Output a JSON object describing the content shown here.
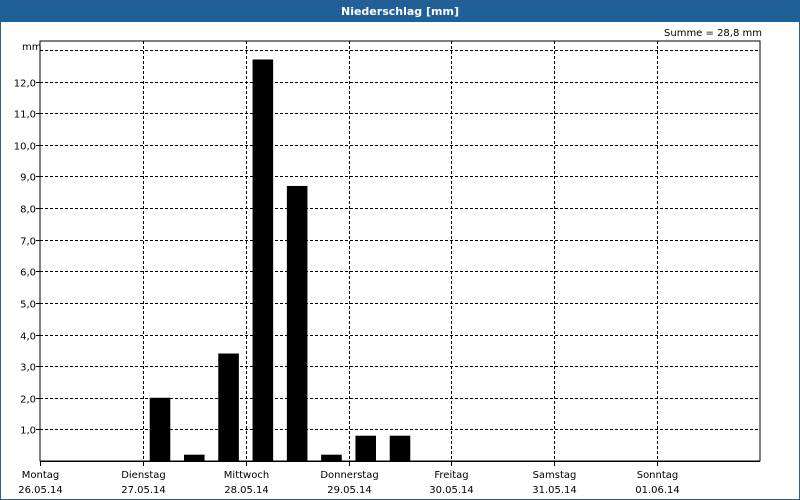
{
  "window": {
    "title": "Niederschlag [mm]"
  },
  "summary": {
    "text": "Summe = 28,8 mm"
  },
  "chart_data": {
    "type": "bar",
    "title": "Niederschlag [mm]",
    "ylabel": "mm",
    "ylim": [
      0,
      13
    ],
    "yticks": [
      {
        "value": 1,
        "label": "1,0"
      },
      {
        "value": 2,
        "label": "2,0"
      },
      {
        "value": 3,
        "label": "3,0"
      },
      {
        "value": 4,
        "label": "4,0"
      },
      {
        "value": 5,
        "label": "5,0"
      },
      {
        "value": 6,
        "label": "6,0"
      },
      {
        "value": 7,
        "label": "7,0"
      },
      {
        "value": 8,
        "label": "8,0"
      },
      {
        "value": 9,
        "label": "9,0"
      },
      {
        "value": 10,
        "label": "10,0"
      },
      {
        "value": 11,
        "label": "11,0"
      },
      {
        "value": 12,
        "label": "12,0"
      }
    ],
    "days": [
      {
        "name": "Montag",
        "date": "26.05.14"
      },
      {
        "name": "Dienstag",
        "date": "27.05.14"
      },
      {
        "name": "Mittwoch",
        "date": "28.05.14"
      },
      {
        "name": "Donnerstag",
        "date": "29.05.14"
      },
      {
        "name": "Freitag",
        "date": "30.05.14"
      },
      {
        "name": "Samstag",
        "date": "31.05.14"
      },
      {
        "name": "Sonntag",
        "date": "01.06.14"
      }
    ],
    "bar_period_days": 0.3333333,
    "bars": [
      {
        "t": 1.1667,
        "value": 2.0
      },
      {
        "t": 1.5,
        "value": 0.2
      },
      {
        "t": 1.8333,
        "value": 3.4
      },
      {
        "t": 2.1667,
        "value": 12.7
      },
      {
        "t": 2.5,
        "value": 8.7
      },
      {
        "t": 2.8333,
        "value": 0.2
      },
      {
        "t": 3.1667,
        "value": 0.8
      },
      {
        "t": 3.5,
        "value": 0.8
      }
    ],
    "grid": true,
    "bar_color": "#000000"
  }
}
